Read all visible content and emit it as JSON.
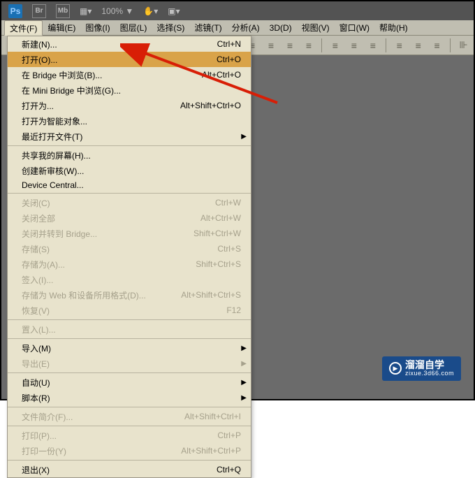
{
  "appbar": {
    "ps": "Ps",
    "br": "Br",
    "mb": "Mb",
    "zoom": "100%",
    "dd": "▼"
  },
  "menubar": {
    "items": [
      "文件(F)",
      "编辑(E)",
      "图像(I)",
      "图层(L)",
      "选择(S)",
      "滤镜(T)",
      "分析(A)",
      "3D(D)",
      "视图(V)",
      "窗口(W)",
      "帮助(H)"
    ]
  },
  "dropdown": {
    "groups": [
      [
        {
          "label": "新建(N)...",
          "shortcut": "Ctrl+N",
          "highlight": false,
          "disabled": false,
          "submenu": false
        },
        {
          "label": "打开(O)...",
          "shortcut": "Ctrl+O",
          "highlight": true,
          "disabled": false,
          "submenu": false
        },
        {
          "label": "在 Bridge 中浏览(B)...",
          "shortcut": "Alt+Ctrl+O",
          "highlight": false,
          "disabled": false,
          "submenu": false
        },
        {
          "label": "在 Mini Bridge 中浏览(G)...",
          "shortcut": "",
          "highlight": false,
          "disabled": false,
          "submenu": false
        },
        {
          "label": "打开为...",
          "shortcut": "Alt+Shift+Ctrl+O",
          "highlight": false,
          "disabled": false,
          "submenu": false
        },
        {
          "label": "打开为智能对象...",
          "shortcut": "",
          "highlight": false,
          "disabled": false,
          "submenu": false
        },
        {
          "label": "最近打开文件(T)",
          "shortcut": "",
          "highlight": false,
          "disabled": false,
          "submenu": true
        }
      ],
      [
        {
          "label": "共享我的屏幕(H)...",
          "shortcut": "",
          "highlight": false,
          "disabled": false,
          "submenu": false
        },
        {
          "label": "创建新审核(W)...",
          "shortcut": "",
          "highlight": false,
          "disabled": false,
          "submenu": false
        },
        {
          "label": "Device Central...",
          "shortcut": "",
          "highlight": false,
          "disabled": false,
          "submenu": false
        }
      ],
      [
        {
          "label": "关闭(C)",
          "shortcut": "Ctrl+W",
          "highlight": false,
          "disabled": true,
          "submenu": false
        },
        {
          "label": "关闭全部",
          "shortcut": "Alt+Ctrl+W",
          "highlight": false,
          "disabled": true,
          "submenu": false
        },
        {
          "label": "关闭并转到 Bridge...",
          "shortcut": "Shift+Ctrl+W",
          "highlight": false,
          "disabled": true,
          "submenu": false
        },
        {
          "label": "存储(S)",
          "shortcut": "Ctrl+S",
          "highlight": false,
          "disabled": true,
          "submenu": false
        },
        {
          "label": "存储为(A)...",
          "shortcut": "Shift+Ctrl+S",
          "highlight": false,
          "disabled": true,
          "submenu": false
        },
        {
          "label": "签入(I)...",
          "shortcut": "",
          "highlight": false,
          "disabled": true,
          "submenu": false
        },
        {
          "label": "存储为 Web 和设备所用格式(D)...",
          "shortcut": "Alt+Shift+Ctrl+S",
          "highlight": false,
          "disabled": true,
          "submenu": false
        },
        {
          "label": "恢复(V)",
          "shortcut": "F12",
          "highlight": false,
          "disabled": true,
          "submenu": false
        }
      ],
      [
        {
          "label": "置入(L)...",
          "shortcut": "",
          "highlight": false,
          "disabled": true,
          "submenu": false
        }
      ],
      [
        {
          "label": "导入(M)",
          "shortcut": "",
          "highlight": false,
          "disabled": false,
          "submenu": true
        },
        {
          "label": "导出(E)",
          "shortcut": "",
          "highlight": false,
          "disabled": true,
          "submenu": true
        }
      ],
      [
        {
          "label": "自动(U)",
          "shortcut": "",
          "highlight": false,
          "disabled": false,
          "submenu": true
        },
        {
          "label": "脚本(R)",
          "shortcut": "",
          "highlight": false,
          "disabled": false,
          "submenu": true
        }
      ],
      [
        {
          "label": "文件简介(F)...",
          "shortcut": "Alt+Shift+Ctrl+I",
          "highlight": false,
          "disabled": true,
          "submenu": false
        }
      ],
      [
        {
          "label": "打印(P)...",
          "shortcut": "Ctrl+P",
          "highlight": false,
          "disabled": true,
          "submenu": false
        },
        {
          "label": "打印一份(Y)",
          "shortcut": "Alt+Shift+Ctrl+P",
          "highlight": false,
          "disabled": true,
          "submenu": false
        }
      ],
      [
        {
          "label": "退出(X)",
          "shortcut": "Ctrl+Q",
          "highlight": false,
          "disabled": false,
          "submenu": false
        }
      ]
    ]
  },
  "watermark": {
    "main": "溜溜自学",
    "sub": "zixue.3d66.com"
  }
}
